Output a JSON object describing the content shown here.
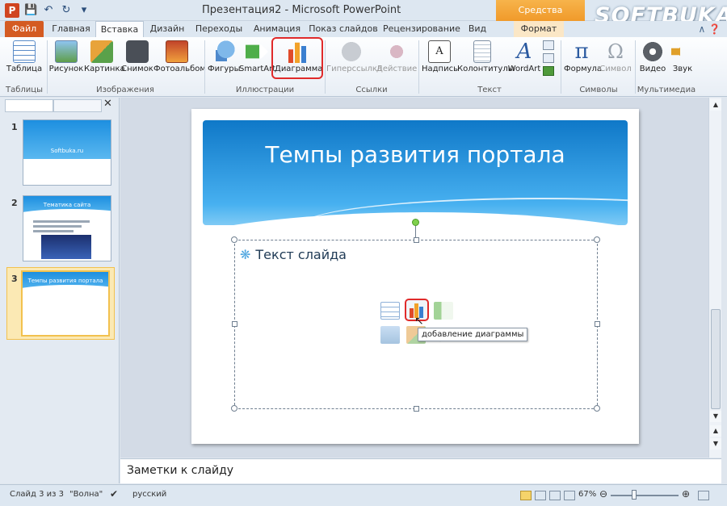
{
  "window": {
    "app_icon": "P",
    "title": "Презентация2 - Microsoft PowerPoint",
    "context_group": "Средства рисования",
    "watermark": "SOFTBUKA"
  },
  "tabs": [
    {
      "label": "Файл"
    },
    {
      "label": "Главная"
    },
    {
      "label": "Вставка"
    },
    {
      "label": "Дизайн"
    },
    {
      "label": "Переходы"
    },
    {
      "label": "Анимация"
    },
    {
      "label": "Показ слайдов"
    },
    {
      "label": "Рецензирование"
    },
    {
      "label": "Вид"
    },
    {
      "label": "Формат"
    }
  ],
  "ribbon": {
    "buttons": {
      "table": "Таблица",
      "picture": "Рисунок",
      "clipart": "Картинка",
      "screenshot": "Снимок",
      "photoalbum": "Фотоальбом",
      "shapes": "Фигуры",
      "smartart": "SmartArt",
      "chart": "Диаграмма",
      "hyperlink": "Гиперссылка",
      "action": "Действие",
      "textbox": "Надпись",
      "headerfooter": "Колонтитулы",
      "wordart": "WordArt",
      "equation": "Формула",
      "symbol": "Символ",
      "video": "Видео",
      "audio": "Звук"
    },
    "groups": {
      "tables": "Таблицы",
      "images": "Изображения",
      "illustrations": "Иллюстрации",
      "links": "Ссылки",
      "text": "Текст",
      "symbols": "Символы",
      "media": "Мультимедиа"
    }
  },
  "slides_pane": {
    "thumbs": [
      {
        "num": "1",
        "title": "Softbuka.ru"
      },
      {
        "num": "2",
        "title": "Тематика сайта"
      },
      {
        "num": "3",
        "title": "Темпы развития портала"
      }
    ]
  },
  "slide": {
    "title": "Темпы развития портала",
    "body_placeholder": "Текст слайда",
    "tooltip": "добавление диаграммы"
  },
  "notes": {
    "placeholder": "Заметки к слайду"
  },
  "status": {
    "slide_info": "Слайд 3 из 3",
    "theme": "\"Волна\"",
    "language": "русский",
    "zoom": "67%"
  },
  "colors": {
    "file_tab": "#d45b22",
    "highlight": "#e02a2a",
    "slide_band": "#1d8fe0",
    "context_tab": "#f09a2a"
  }
}
